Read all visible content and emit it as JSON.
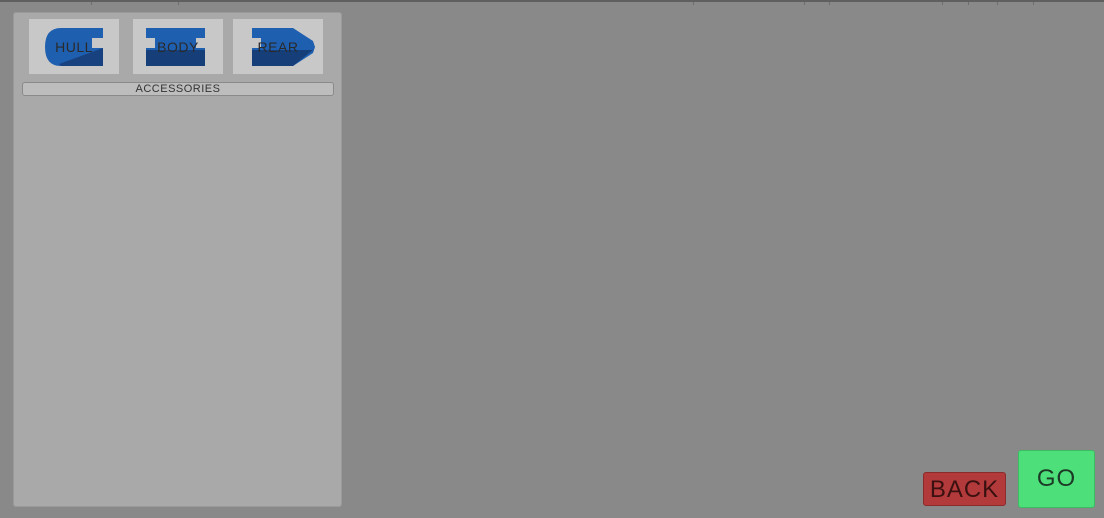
{
  "parts": [
    {
      "label": "HULL",
      "icon": "hull-part-icon"
    },
    {
      "label": "BODY",
      "icon": "body-part-icon"
    },
    {
      "label": "REAR",
      "icon": "rear-part-icon"
    }
  ],
  "accessories": {
    "label": "ACCESSORIES"
  },
  "actions": {
    "back_label": "BACK",
    "go_label": "GO"
  },
  "colors": {
    "background": "#898989",
    "panel": "#a9a9a9",
    "part_blue": "#1f5fb0",
    "part_blue_dark": "#163f7a",
    "back_button": "#b23a3a",
    "go_button": "#4de07a"
  }
}
